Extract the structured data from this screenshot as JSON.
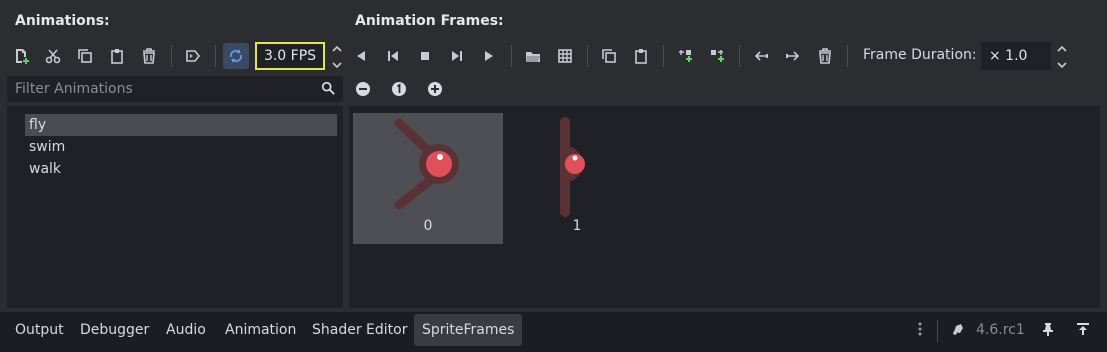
{
  "animations_panel": {
    "title": "Animations:",
    "fps_value": "3.0 FPS",
    "filter_placeholder": "Filter Animations",
    "items": [
      {
        "label": "fly",
        "selected": true
      },
      {
        "label": "swim",
        "selected": false
      },
      {
        "label": "walk",
        "selected": false
      }
    ],
    "toolbar_icons": [
      "new-animation-icon",
      "cut-icon",
      "duplicate-icon",
      "paste-icon",
      "delete-icon",
      "autoplay-icon",
      "loop-icon"
    ]
  },
  "frames_panel": {
    "title": "Animation Frames:",
    "frame_duration_label": "Frame Duration:",
    "frame_duration_value": "× 1.0",
    "frames": [
      {
        "index": "0",
        "selected": true
      },
      {
        "index": "1",
        "selected": false
      }
    ],
    "toolbar_icons": [
      "play-backwards-from-end-icon",
      "play-backwards-icon",
      "stop-icon",
      "play-from-start-icon",
      "play-icon",
      "open-folder-icon",
      "grid-icon",
      "copy-icon",
      "paste-icon",
      "insert-before-icon",
      "insert-after-icon",
      "move-left-icon",
      "move-right-icon",
      "delete-frame-icon"
    ],
    "zoom_icons": [
      "zoom-out-icon",
      "zoom-reset-icon",
      "zoom-in-icon"
    ]
  },
  "bottom_tabs": {
    "tabs": [
      {
        "label": "Output",
        "active": false
      },
      {
        "label": "Debugger",
        "active": false
      },
      {
        "label": "Audio",
        "active": false
      },
      {
        "label": "Animation",
        "active": false
      },
      {
        "label": "Shader Editor",
        "active": false
      },
      {
        "label": "SpriteFrames",
        "active": true
      }
    ],
    "version": "4.6.rc1"
  },
  "colors": {
    "accent_blue": "#5d9cf5",
    "fps_highlight": "#e6e34d",
    "add_green": "#5fd068",
    "sprite_dark": "#5a3236",
    "sprite_red": "#e0505a"
  }
}
